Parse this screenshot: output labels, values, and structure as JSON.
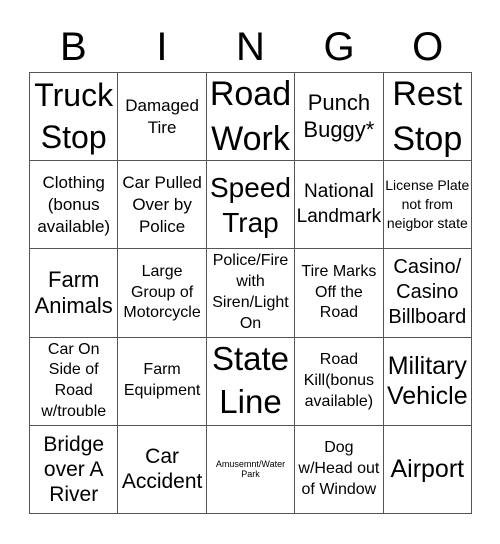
{
  "header": {
    "letters": [
      "B",
      "I",
      "N",
      "G",
      "O"
    ]
  },
  "board": {
    "rows": [
      [
        "Truck Stop",
        "Damaged Tire",
        "Road Work",
        "Punch Buggy*",
        "Rest Stop"
      ],
      [
        "Clothing (bonus available)",
        "Car Pulled Over by Police",
        "Speed Trap",
        "National Landmark",
        "License Plate not from neigbor state"
      ],
      [
        "Farm Animals",
        "Large Group of Motorcycle",
        "Police/Fire with Siren/Light On",
        "Tire Marks Off the Road",
        "Casino/ Casino Billboard"
      ],
      [
        "Car On Side of Road w/trouble",
        "Farm Equipment",
        "State Line",
        "Road Kill(bonus available)",
        "Military Vehicle"
      ],
      [
        "Bridge over A River",
        "Car Accident",
        "Amusemnt/Water Park",
        "Dog w/Head out of Window",
        "Airport"
      ]
    ]
  }
}
